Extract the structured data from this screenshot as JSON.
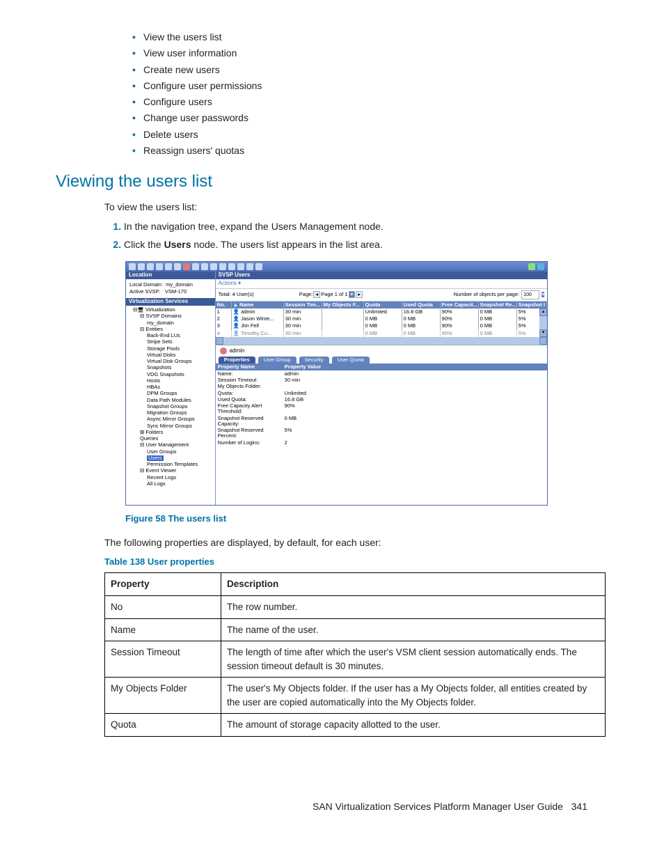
{
  "bullets": [
    "View the users list",
    "View user information",
    "Create new users",
    "Configure user permissions",
    "Configure users",
    "Change user passwords",
    "Delete users",
    "Reassign users' quotas"
  ],
  "heading": "Viewing the users list",
  "intro": "To view the users list:",
  "steps": {
    "s1": "In the navigation tree, expand the Users Management node.",
    "s2a": "Click the ",
    "s2b": "Users",
    "s2c": " node. The users list appears in the list area."
  },
  "screenshot": {
    "location_label": "Location",
    "local_domain_label": "Local Domain:",
    "local_domain_value": "my_domain",
    "active_svsp_label": "Active SVSP:",
    "active_svsp_value": "VSM-170",
    "services_label": "Virtualization Services",
    "tree": {
      "root": "Virtualization",
      "svsp": "SVSP Domains",
      "my_domain": "my_domain",
      "entities": "Entities",
      "belu": "Back-End LUs",
      "stripe": "Stripe Sets",
      "pools": "Storage Pools",
      "vdisks": "Virtual Disks",
      "vdgroups": "Virtual Disk Groups",
      "snapshots": "Snapshots",
      "vdgsnap": "VDG Snapshots",
      "hosts": "Hosts",
      "hbas": "HBAs",
      "dpm": "DPM Groups",
      "dpmods": "Data Path Modules",
      "snapgroups": "Snapshot Groups",
      "miggroups": "Migration Groups",
      "async": "Async Mirror Groups",
      "sync": "Sync Mirror Groups",
      "folders": "Folders",
      "queries": "Queries",
      "usermgmt": "User Management",
      "ugroups": "User Groups",
      "users": "Users",
      "ptemplates": "Permission Templates",
      "eventviewer": "Event Viewer",
      "recentlogs": "Recent Logs",
      "alllogs": "All Logs"
    },
    "panel_title": "SVSP Users",
    "actions": "Actions ▾",
    "total": "Total: 4 User(s)",
    "page_label": "Page:",
    "page_info": "Page 1 of 1",
    "objs_label": "Number of objects per page:",
    "objs_value": "100",
    "columns": {
      "no": "No.",
      "name": "Name",
      "session": "Session Tim...",
      "myobj": "My Objects F...",
      "quota": "Quota",
      "used_quota": "Used Quota",
      "free_cap": "Free Capacit...",
      "snap_res": "Snapshot Re...",
      "snap_i": "Snapshot I"
    },
    "rows": [
      {
        "no": "1",
        "name": "admin",
        "st": "30  min",
        "mo": "",
        "q": "Unlimited",
        "uq": "16.8  GB",
        "fc": "90%",
        "sr": "0  MB",
        "si": "5%"
      },
      {
        "no": "2",
        "name": "Jason Winte...",
        "st": "30  min",
        "mo": "",
        "q": "0  MB",
        "uq": "0  MB",
        "fc": "90%",
        "sr": "0  MB",
        "si": "5%"
      },
      {
        "no": "3",
        "name": "Jim Fell",
        "st": "30  min",
        "mo": "",
        "q": "0  MB",
        "uq": "0  MB",
        "fc": "90%",
        "sr": "0  MB",
        "si": "5%"
      },
      {
        "no": "4",
        "name": "Timothy Cu...",
        "st": "30  min",
        "mo": "",
        "q": "0  MB",
        "uq": "0  MB",
        "fc": "90%",
        "sr": "0  MB",
        "si": "5%"
      }
    ],
    "detail": {
      "user": "admin",
      "tabs": {
        "props": "Properties",
        "group": "User Group",
        "sec": "Security",
        "quota": "User Quota"
      },
      "col_name": "Property Name",
      "col_val": "Property Value",
      "props": [
        {
          "n": "Name:",
          "v": "admin"
        },
        {
          "n": "Session Timeout:",
          "v": "30  min"
        },
        {
          "n": "My Objects Folder:",
          "v": ""
        },
        {
          "n": "Quota:",
          "v": "Unlimited"
        },
        {
          "n": "Used Quota:",
          "v": "16.8  GB"
        },
        {
          "n": "Free Capacity Alert Threshold:",
          "v": "90%"
        },
        {
          "n": "Snapshot Reserved Capacity:",
          "v": "0  MB"
        },
        {
          "n": "Snapshot Reserved Percent:",
          "v": "5%"
        },
        {
          "n": "Number of Logins:",
          "v": "2"
        }
      ]
    }
  },
  "figure_caption": "Figure 58 The users list",
  "following_text": "The following properties are displayed, by default, for each user:",
  "table_caption": "Table 138 User properties",
  "table": {
    "h1": "Property",
    "h2": "Description",
    "rows": [
      {
        "p": "No",
        "d": "The row number."
      },
      {
        "p": "Name",
        "d": "The name of the user."
      },
      {
        "p": "Session Timeout",
        "d": "The length of time after which the user's VSM client session automatically ends. The session timeout default is 30 minutes."
      },
      {
        "p": "My Objects Folder",
        "d": "The user's My Objects folder. If the user has a My Objects folder, all entities created by the user are copied automatically into the My Objects folder."
      },
      {
        "p": "Quota",
        "d": "The amount of storage capacity allotted to the user."
      }
    ]
  },
  "footer": {
    "title": "SAN Virtualization Services Platform Manager User Guide",
    "page": "341"
  }
}
